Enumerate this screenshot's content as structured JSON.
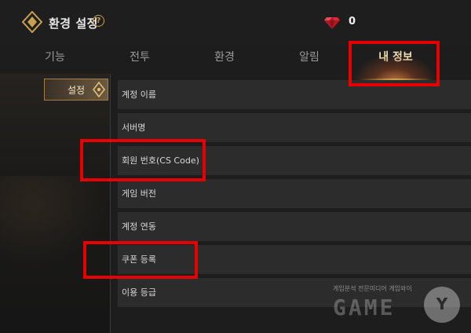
{
  "header": {
    "title": "환경 설정",
    "help_glyph": "?",
    "currency_icon": "ruby-gem-icon",
    "currency_count": "0"
  },
  "tabs": [
    {
      "label": "기능",
      "active": false
    },
    {
      "label": "전투",
      "active": false
    },
    {
      "label": "환경",
      "active": false
    },
    {
      "label": "알림",
      "active": false
    },
    {
      "label": "내 정보",
      "active": true
    }
  ],
  "sidebar": {
    "items": [
      {
        "label": "설정",
        "active": true
      }
    ]
  },
  "list": [
    {
      "label": "계정 이름"
    },
    {
      "label": "서버명"
    },
    {
      "label": "회원 번호(CS Code)"
    },
    {
      "label": "게임 버전"
    },
    {
      "label": "계정 연동"
    },
    {
      "label": "쿠폰 등록"
    },
    {
      "label": "이용 등급"
    }
  ],
  "watermark": {
    "caption": "게임분석 전문미디어 게임와이",
    "brand": "GAME",
    "badge": "Y"
  },
  "colors": {
    "highlight": "#e60000",
    "accent_gold": "#c9a04e",
    "row_bg": "#2c2c2c",
    "page_bg": "#1d1d1d"
  }
}
